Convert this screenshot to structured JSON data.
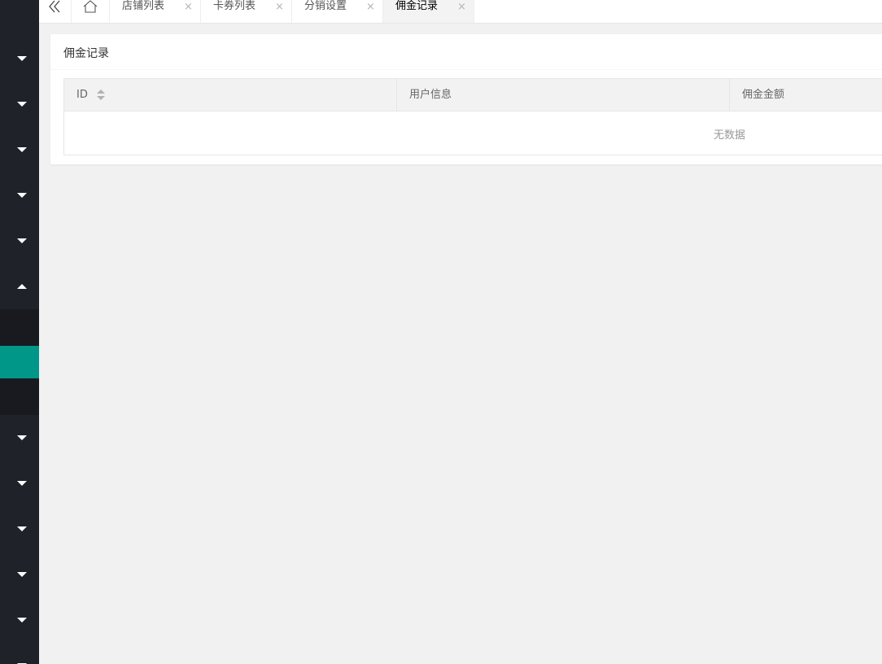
{
  "tabs": {
    "items": [
      {
        "label": "店铺列表",
        "close": "×"
      },
      {
        "label": "卡券列表",
        "close": "×"
      },
      {
        "label": "分销设置",
        "close": "×"
      },
      {
        "label": "佣金记录",
        "close": "×"
      }
    ],
    "active_index": 3
  },
  "sidebar": {
    "items": [
      {
        "icon": "chevron-down-icon"
      },
      {
        "icon": "chevron-down-icon"
      },
      {
        "icon": "chevron-down-icon"
      },
      {
        "icon": "chevron-down-icon"
      },
      {
        "icon": "chevron-down-icon"
      },
      {
        "icon": "chevron-up-icon"
      },
      {
        "icon": "chevron-down-icon"
      },
      {
        "icon": "chevron-down-icon"
      },
      {
        "icon": "chevron-down-icon"
      },
      {
        "icon": "chevron-down-icon"
      },
      {
        "icon": "chevron-down-icon"
      }
    ],
    "accent_color": "#009688"
  },
  "card": {
    "title": "佣金记录"
  },
  "table": {
    "columns": [
      {
        "label": "ID",
        "sortable": true
      },
      {
        "label": "用户信息"
      },
      {
        "label": "佣金金额"
      }
    ],
    "empty_text": "无数据"
  }
}
